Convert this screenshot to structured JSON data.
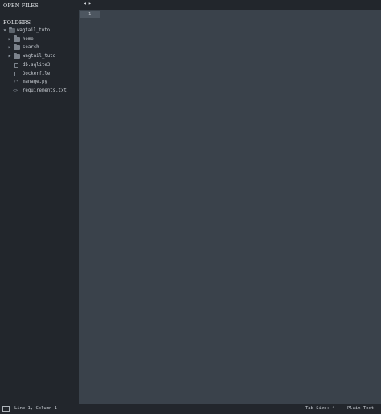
{
  "sidebar": {
    "open_files_heading": "OPEN FILES",
    "folders_heading": "FOLDERS",
    "root_folder": {
      "label": "wagtail_tuto",
      "expanded": true,
      "arrow_icon": "triangle-down-icon",
      "icon": "open-folder-icon"
    },
    "items": [
      {
        "label": "home",
        "type": "folder",
        "arrow_icon": "triangle-right-icon",
        "icon": "folder-icon"
      },
      {
        "label": "search",
        "type": "folder",
        "arrow_icon": "triangle-right-icon",
        "icon": "folder-icon"
      },
      {
        "label": "wagtail_tuto",
        "type": "folder",
        "arrow_icon": "triangle-right-icon",
        "icon": "folder-icon"
      },
      {
        "label": "db.sqlite3",
        "type": "file",
        "icon": "file-icon"
      },
      {
        "label": "Dockerfile",
        "type": "file",
        "icon": "file-icon"
      },
      {
        "label": "manage.py",
        "type": "file",
        "icon": "python-file-icon",
        "glyph": "/*"
      },
      {
        "label": "requirements.txt",
        "type": "file",
        "icon": "text-file-icon",
        "glyph": "<>"
      }
    ]
  },
  "topbar": {
    "back_icon": "◂",
    "forward_icon": "▸"
  },
  "editor": {
    "line_number": "1"
  },
  "statusbar": {
    "panel_icon": "panel-toggle-icon",
    "position": "Line 1, Column 1",
    "tab_size": "Tab Size: 4",
    "syntax": "Plain Text"
  },
  "colors": {
    "sidebar_bg": "#22262c",
    "editor_bg": "#3a424b",
    "current_line_bg": "#4d5660",
    "text": "#c8cdd3"
  }
}
